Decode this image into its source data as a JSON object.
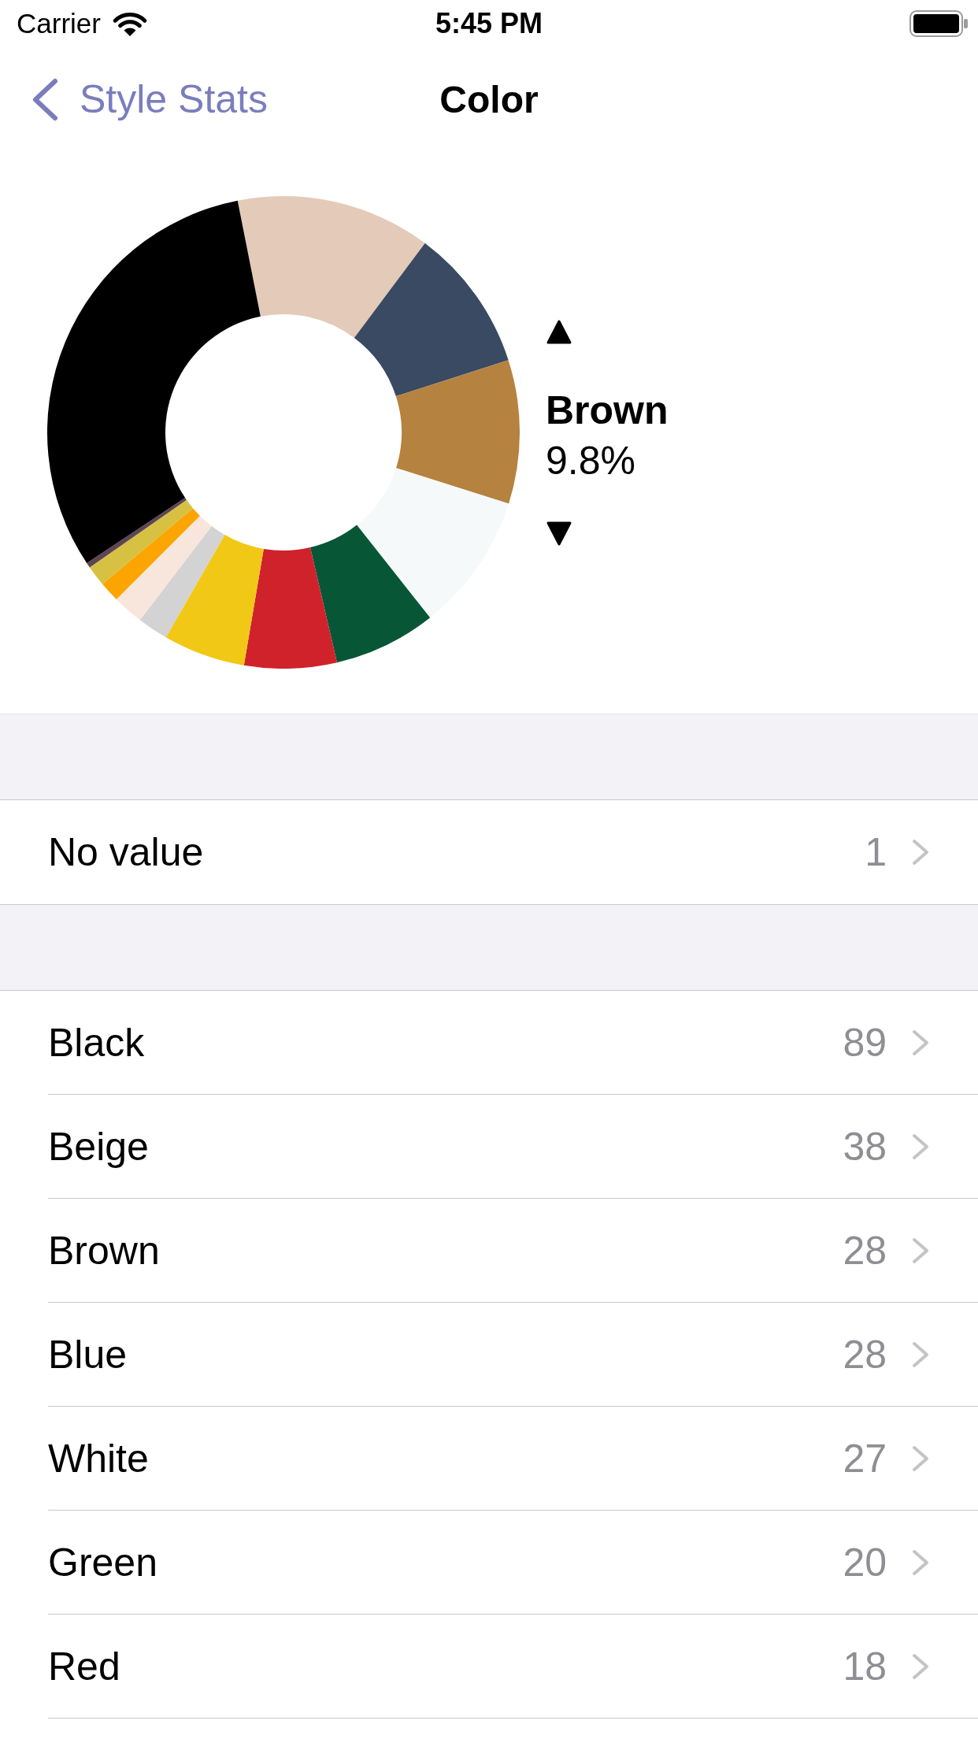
{
  "status_bar": {
    "carrier": "Carrier",
    "time": "5:45 PM"
  },
  "nav_bar": {
    "back": "Style Stats",
    "title": "Color"
  },
  "chart": {
    "selected_name": "Brown",
    "selected_percent": "9.8%"
  },
  "sections": [
    {
      "rows": [
        {
          "label": "No value",
          "count": "1"
        }
      ]
    },
    {
      "rows": [
        {
          "label": "Black",
          "count": "89"
        },
        {
          "label": "Beige",
          "count": "38"
        },
        {
          "label": "Brown",
          "count": "28"
        },
        {
          "label": "Blue",
          "count": "28"
        },
        {
          "label": "White",
          "count": "27"
        },
        {
          "label": "Green",
          "count": "20"
        },
        {
          "label": "Red",
          "count": "18"
        }
      ]
    }
  ]
}
